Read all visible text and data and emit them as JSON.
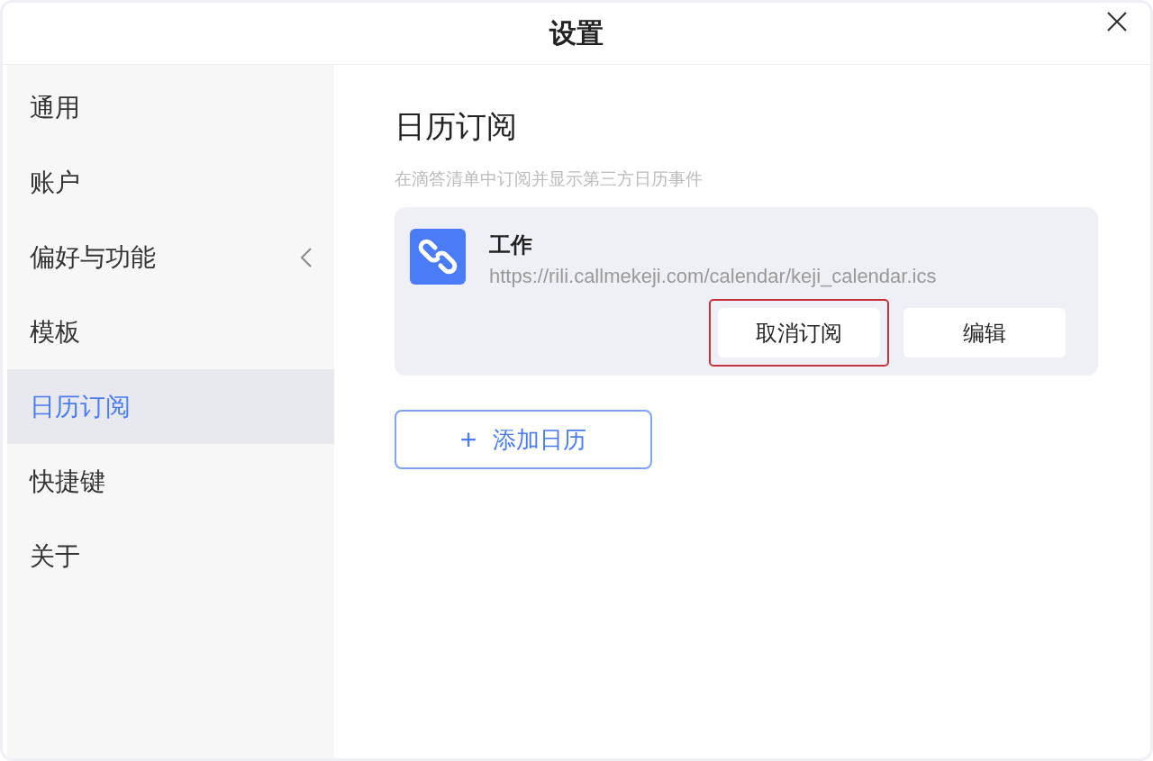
{
  "window": {
    "title": "设置"
  },
  "sidebar": {
    "items": [
      {
        "label": "通用",
        "selected": false,
        "has_submenu": false
      },
      {
        "label": "账户",
        "selected": false,
        "has_submenu": false
      },
      {
        "label": "偏好与功能",
        "selected": false,
        "has_submenu": true
      },
      {
        "label": "模板",
        "selected": false,
        "has_submenu": false
      },
      {
        "label": "日历订阅",
        "selected": true,
        "has_submenu": false
      },
      {
        "label": "快捷键",
        "selected": false,
        "has_submenu": false
      },
      {
        "label": "关于",
        "selected": false,
        "has_submenu": false
      }
    ]
  },
  "content": {
    "heading": "日历订阅",
    "subtitle": "在滴答清单中订阅并显示第三方日历事件",
    "subscriptions": [
      {
        "name": "工作",
        "url": "https://rili.callmekeji.com/calendar/keji_calendar.ics",
        "buttons": [
          {
            "label": "取消订阅",
            "highlighted": true
          },
          {
            "label": "编辑",
            "highlighted": false
          }
        ]
      }
    ],
    "add_button": {
      "icon": "+",
      "label": "添加日历"
    }
  }
}
